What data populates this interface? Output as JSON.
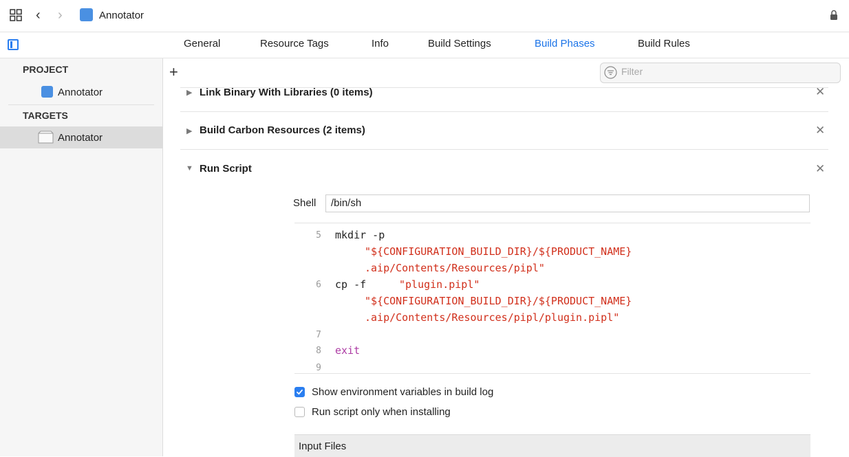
{
  "window": {
    "project_title": "Annotator"
  },
  "tabs": [
    {
      "label": "General"
    },
    {
      "label": "Resource Tags"
    },
    {
      "label": "Info"
    },
    {
      "label": "Build Settings"
    },
    {
      "label": "Build Phases"
    },
    {
      "label": "Build Rules"
    }
  ],
  "active_tab": "Build Phases",
  "sidebar": {
    "project_header": "PROJECT",
    "project_item": "Annotator",
    "targets_header": "TARGETS",
    "target_item": "Annotator"
  },
  "filter": {
    "placeholder": "Filter"
  },
  "phases": [
    {
      "title": "Link Binary With Libraries (0 items)",
      "expanded": false
    },
    {
      "title": "Build Carbon Resources (2 items)",
      "expanded": false
    },
    {
      "title": "Run Script",
      "expanded": true
    }
  ],
  "run_script": {
    "shell_label": "Shell",
    "shell_value": "/bin/sh",
    "lines": [
      {
        "num": "5",
        "parts": [
          "mkdir -p",
          "\"${CONFIGURATION_BUILD_DIR}/${PRODUCT_NAME}",
          ".aip/Contents/Resources/pipl\""
        ]
      },
      {
        "num": "6",
        "parts": [
          "cp -f",
          "\"plugin.pipl\"",
          "\"${CONFIGURATION_BUILD_DIR}/${PRODUCT_NAME}",
          ".aip/Contents/Resources/pipl/plugin.pipl\""
        ]
      },
      {
        "num": "7",
        "parts": []
      },
      {
        "num": "8",
        "parts": [
          "exit"
        ]
      },
      {
        "num": "9",
        "parts": []
      }
    ],
    "show_env_label": "Show environment variables in build log",
    "show_env_checked": true,
    "run_only_installing_label": "Run script only when installing",
    "run_only_installing_checked": false,
    "input_files_label": "Input Files"
  },
  "colors": {
    "accent": "#1a73e8",
    "string": "#d12f1b",
    "keyword": "#ad3da4"
  }
}
